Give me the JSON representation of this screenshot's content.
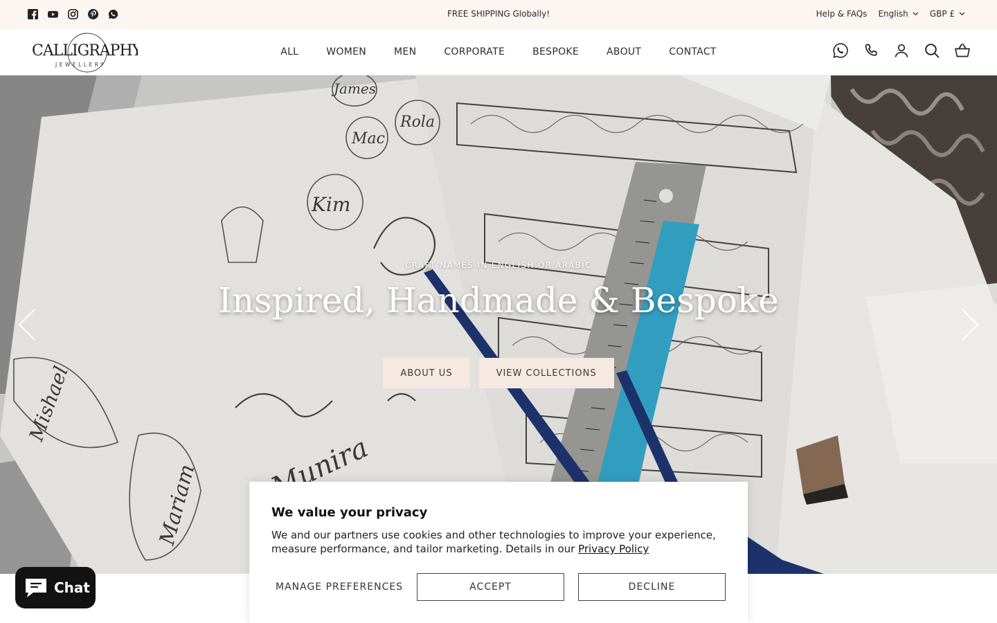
{
  "announcement": "FREE SHIPPING Globally!",
  "social": [
    "facebook-icon",
    "youtube-icon",
    "instagram-icon",
    "pinterest-icon",
    "whatsapp-icon"
  ],
  "utility": {
    "help": "Help & FAQs",
    "language": "English",
    "currency": "GBP £"
  },
  "brand": {
    "name": "CALLIGRAPHY",
    "sub": "JEWELLERY"
  },
  "nav": [
    "ALL",
    "WOMEN",
    "MEN",
    "CORPORATE",
    "BESPOKE",
    "ABOUT",
    "CONTACT"
  ],
  "header_icons": [
    "whatsapp-icon",
    "phone-icon",
    "account-icon",
    "search-icon",
    "basket-icon"
  ],
  "hero": {
    "kicker": "CRAFT NAMES IN ENGLISH OR ARABIC",
    "title": "Inspired, Handmade & Bespoke",
    "buttons": [
      "ABOUT US",
      "VIEW COLLECTIONS"
    ],
    "sketch_names": [
      "James",
      "Mac",
      "Rola",
      "Kim",
      "Mishael",
      "Munira",
      "Mariam"
    ]
  },
  "cookie": {
    "title": "We value your privacy",
    "text": "We and our partners use cookies and other technologies to improve your experience, measure performance, and tailor marketing. Details in our",
    "link": "Privacy Policy",
    "manage": "MANAGE PREFERENCES",
    "accept": "ACCEPT",
    "decline": "DECLINE"
  },
  "chat": {
    "label": "Chat"
  },
  "colors": {
    "topbar_bg": "#fcf6f3",
    "button_bg": "#f5e9e2",
    "chat_bg": "#121212"
  }
}
